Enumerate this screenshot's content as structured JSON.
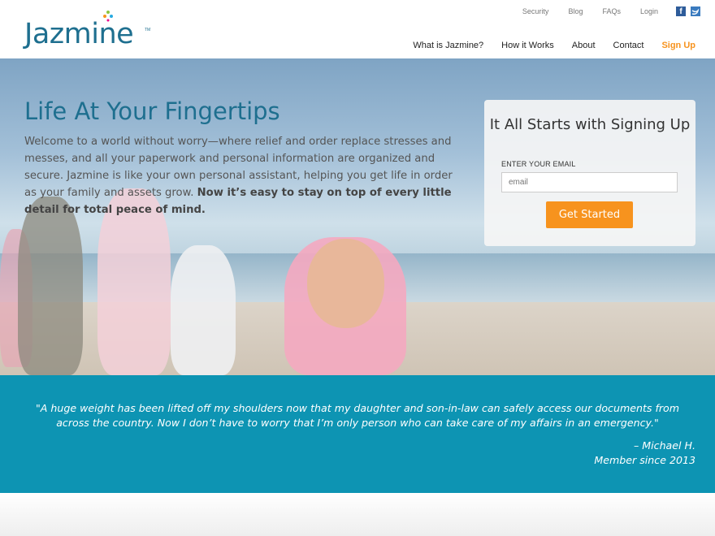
{
  "header": {
    "logo_text": "Jazmine",
    "logo_tm": "TM",
    "top_links": [
      "Security",
      "Blog",
      "FAQs",
      "Login"
    ],
    "social": [
      "facebook-icon",
      "twitter-icon"
    ],
    "nav": [
      "What is Jazmine?",
      "How it Works",
      "About",
      "Contact"
    ],
    "signup": "Sign Up"
  },
  "hero": {
    "title": "Life At Your Fingertips",
    "body": "Welcome to a world without worry—where relief and order replace stresses and messes, and all your paperwork and personal information are organized and secure. Jazmine is like your own personal assistant, helping you get life in order as your family and assets grow.",
    "body_bold": "Now it’s easy to stay on top of every little detail for total peace of mind."
  },
  "signup_card": {
    "title": "It All Starts with Signing Up",
    "email_label": "ENTER YOUR EMAIL",
    "email_placeholder": "email",
    "button": "Get Started"
  },
  "testimonial": {
    "quote": "\"A huge weight has been lifted off my shoulders now that my daughter and son-in-law can safely access our documents from across the country. Now I don’t have to worry that I’m only person who can take care of my affairs in an emergency.\"",
    "author": "– Michael H.",
    "member_since": "Member since 2013"
  },
  "colors": {
    "brand": "#1e6f8f",
    "accent": "#f7931e",
    "testimonial_bg": "#0d94b3"
  }
}
